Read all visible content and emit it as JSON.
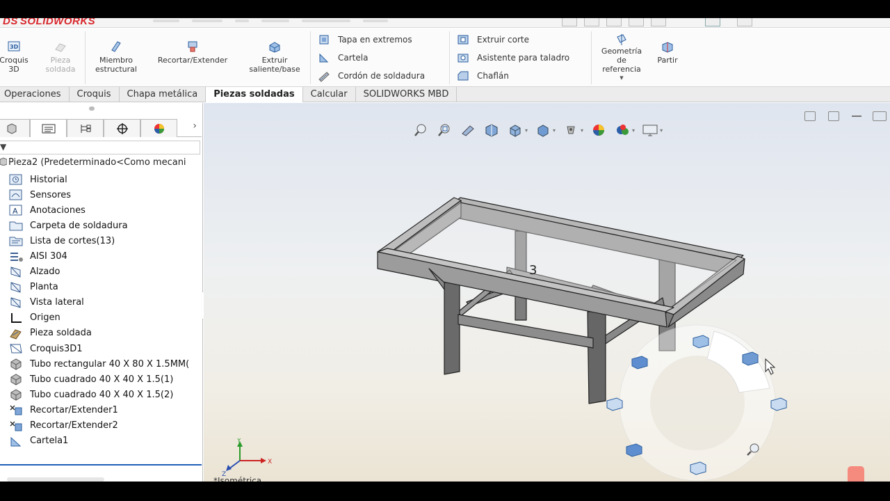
{
  "app": {
    "logo_text": "SOLIDWORKS",
    "logo_mark": "DS"
  },
  "ribbon": {
    "big_buttons": [
      {
        "id": "croquis3d",
        "label": "Croquis\n3D",
        "icon": "croquis-3d-icon",
        "enabled": true
      },
      {
        "id": "pieza_soldada",
        "label": "Pieza\nsoldada",
        "icon": "weldment-icon",
        "enabled": false
      },
      {
        "id": "miembro",
        "label": "Miembro\nestructural",
        "icon": "structural-member-icon",
        "enabled": true
      },
      {
        "id": "recortar",
        "label": "Recortar/Extender",
        "icon": "trim-extend-icon",
        "enabled": true
      },
      {
        "id": "extruir",
        "label": "Extruir\nsaliente/base",
        "icon": "extrude-boss-icon",
        "enabled": true
      }
    ],
    "col1": [
      "Tapa en extremos",
      "Cartela",
      "Cordón de soldadura"
    ],
    "col2": [
      "Extruir corte",
      "Asistente para taladro",
      "Chaflán"
    ],
    "ref_geometry": "Geometría\nde\nreferencia",
    "split": "Partir"
  },
  "tabs": [
    {
      "label": "Operaciones",
      "active": false
    },
    {
      "label": "Croquis",
      "active": false
    },
    {
      "label": "Chapa metálica",
      "active": false
    },
    {
      "label": "Piezas soldadas",
      "active": true
    },
    {
      "label": "Calcular",
      "active": false
    },
    {
      "label": "SOLIDWORKS MBD",
      "active": false
    }
  ],
  "tree": {
    "root": "Pieza2  (Predeterminado<Como mecani",
    "items": [
      {
        "label": "Historial",
        "icon": "history-icon"
      },
      {
        "label": "Sensores",
        "icon": "sensor-icon"
      },
      {
        "label": "Anotaciones",
        "icon": "annotations-icon"
      },
      {
        "label": "Carpeta de soldadura",
        "icon": "weld-folder-icon"
      },
      {
        "label": "Lista de cortes(13)",
        "icon": "cut-list-icon"
      },
      {
        "label": "AISI 304",
        "icon": "material-icon"
      },
      {
        "label": "Alzado",
        "icon": "plane-icon"
      },
      {
        "label": "Planta",
        "icon": "plane-icon"
      },
      {
        "label": "Vista lateral",
        "icon": "plane-icon"
      },
      {
        "label": "Origen",
        "icon": "origin-icon"
      },
      {
        "label": "Pieza soldada",
        "icon": "weldment-icon"
      },
      {
        "label": "Croquis3D1",
        "icon": "sketch-icon"
      },
      {
        "label": "Tubo rectangular 40 X 80 X 1.5MM(",
        "icon": "structural-member-icon"
      },
      {
        "label": "Tubo cuadrado 40 X 40 X 1.5(1)",
        "icon": "structural-member-icon"
      },
      {
        "label": "Tubo cuadrado 40 X 40 X 1.5(2)",
        "icon": "structural-member-icon"
      },
      {
        "label": "Recortar/Extender1",
        "icon": "trim-extend-icon"
      },
      {
        "label": "Recortar/Extender2",
        "icon": "trim-extend-icon"
      },
      {
        "label": "Cartela1",
        "icon": "gusset-icon"
      }
    ]
  },
  "viewport": {
    "view_label": "*Isométrica",
    "triad": {
      "x": "X",
      "y": "Y",
      "z": "Z"
    },
    "annotation": "3"
  },
  "colors": {
    "accent": "#1f5fb8",
    "frame_face": "#9a9a9a",
    "frame_dark": "#4a4a4a",
    "logo": "#d8262b"
  }
}
